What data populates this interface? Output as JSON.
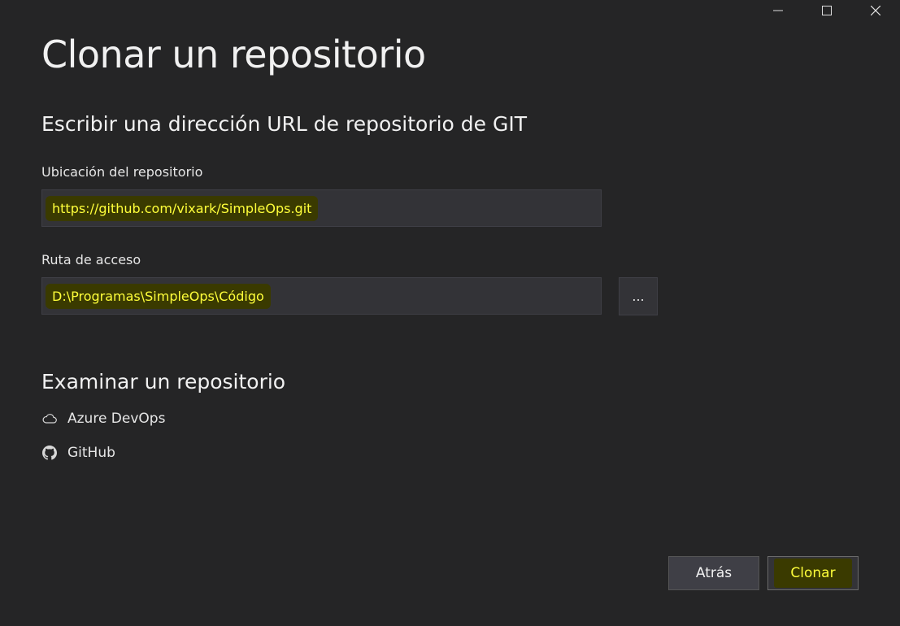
{
  "window": {
    "controls": {
      "minimize_icon": "minimize-icon",
      "maximize_icon": "maximize-icon",
      "close_icon": "close-icon"
    }
  },
  "page": {
    "title": "Clonar un repositorio"
  },
  "clone_url": {
    "heading": "Escribir una dirección URL de repositorio de GIT",
    "location_label": "Ubicación del repositorio",
    "location_value": "https://github.com/vixark/SimpleOps.git",
    "path_label": "Ruta de acceso",
    "path_value": "D:\\Programas\\SimpleOps\\Código",
    "browse_label": "..."
  },
  "browse": {
    "heading": "Examinar un repositorio",
    "providers": [
      {
        "label": "Azure DevOps",
        "icon": "cloud-icon"
      },
      {
        "label": "GitHub",
        "icon": "github-icon"
      }
    ]
  },
  "footer": {
    "back_label": "Atrás",
    "clone_label": "Clonar"
  },
  "colors": {
    "background": "#252526",
    "field_bg": "#333337",
    "highlight_text": "#ffff3a",
    "highlight_bg": "#3a3a00"
  }
}
